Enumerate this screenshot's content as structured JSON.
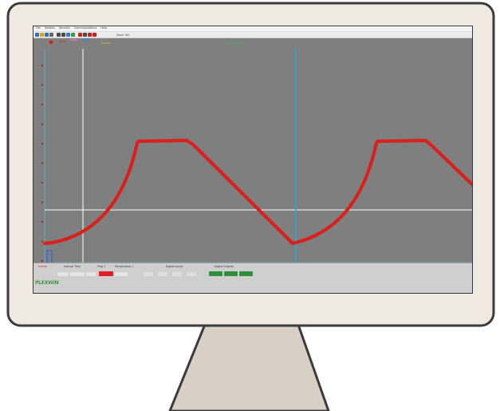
{
  "menu": {
    "items": [
      "File",
      "Options",
      "Security",
      "Communications",
      "Help"
    ]
  },
  "toolbar": {
    "buttons": [
      {
        "name": "new-icon",
        "color": "#3d6db5"
      },
      {
        "name": "open-icon",
        "color": "#d9a21b"
      },
      {
        "name": "save-icon",
        "color": "#3d6db5"
      },
      {
        "name": "print-icon",
        "color": "#666666"
      },
      {
        "name": "zoom-in-icon",
        "color": "#4a4a4a"
      },
      {
        "name": "zoom-out-icon",
        "color": "#4a4a4a"
      },
      {
        "name": "pan-icon",
        "color": "#2f7bd1"
      },
      {
        "name": "reset-icon",
        "color": "#2f9e3e"
      },
      {
        "name": "cursor-icon",
        "color": "#c02525"
      },
      {
        "name": "grid-icon",
        "color": "#4a4a4a"
      },
      {
        "name": "record-icon",
        "color": "#c02525"
      },
      {
        "name": "stop-icon",
        "color": "#c02525"
      }
    ],
    "zoom_label": "Zoom 100"
  },
  "header": {
    "trace_label": "Temp",
    "yellow_label": "Setpoint",
    "green_label": "Process Value"
  },
  "status": {
    "caption_start": "Events",
    "caption_hold": "Interval Time",
    "caption_prog": "Prog 1",
    "caption_temp": "Temperature 1",
    "caption_inputs": "Digital Inputs",
    "caption_outputs": "Digital Outputs",
    "brand": "PLEXWIN"
  },
  "colors": {
    "plot_bg": "#7f7f7f",
    "trace": "#d8201c",
    "cursor_v": "#2aa6d8",
    "crosshair": "#ffffff",
    "screen_frame": "#3a3a3a",
    "bezel": "#f0e9e2",
    "bezel_edge": "#3b3b3b",
    "stand": "#d8cfc5"
  }
}
